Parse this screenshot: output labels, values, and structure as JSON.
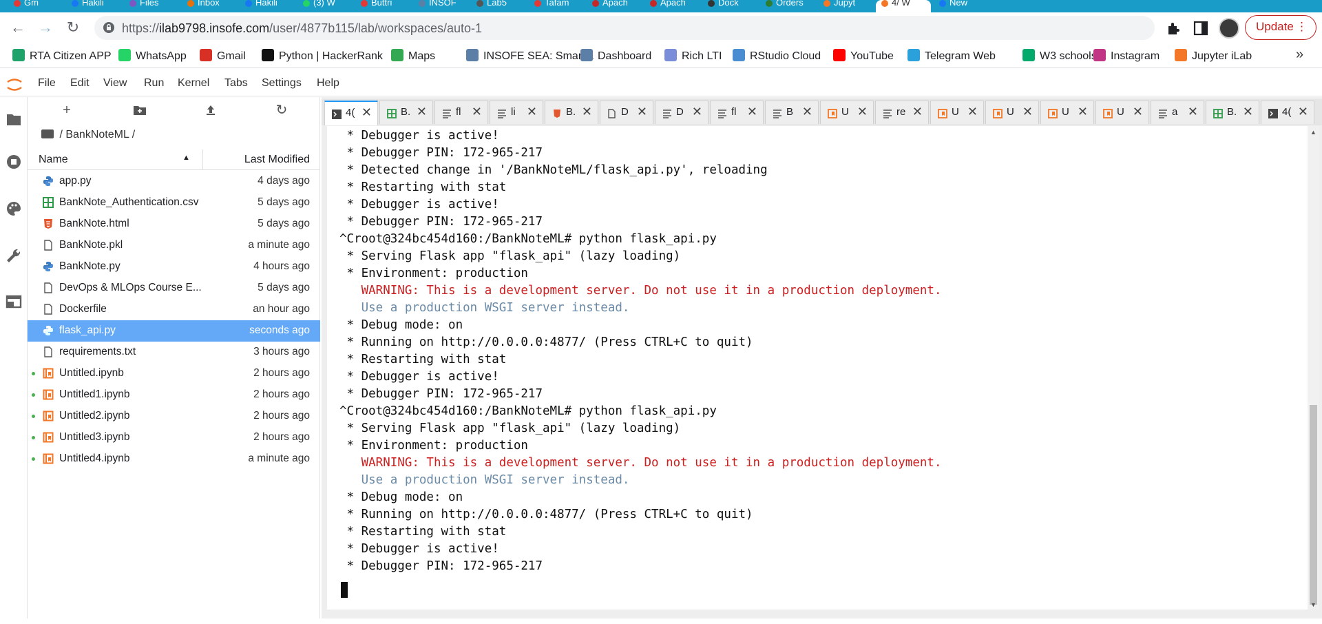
{
  "browser": {
    "tabs": [
      "Gm",
      "Hakili",
      "Files",
      "Inbox",
      "Hakili",
      "(3) W",
      "Buttri",
      "INSOF",
      "Lab5",
      "Tafam",
      "Apach",
      "Apach",
      "Dock",
      "Orders",
      "Jupyt",
      "4/ W",
      "New"
    ],
    "url_prefix": "https://",
    "url_domain": "ilab9798.insofe.com",
    "url_path": "/user/4877b115/lab/workspaces/auto-1",
    "update_label": "Update"
  },
  "bookmarks": [
    {
      "label": "RTA Citizen APP",
      "color": "#1fa36b"
    },
    {
      "label": "WhatsApp",
      "color": "#25d366"
    },
    {
      "label": "Gmail",
      "color": "#d93025"
    },
    {
      "label": "Python | HackerRank",
      "color": "#111111"
    },
    {
      "label": "Maps",
      "color": "#34a853"
    },
    {
      "label": "INSOFE SEA: Smart...",
      "color": "#5b7fa6"
    },
    {
      "label": "Dashboard",
      "color": "#5b7fa6"
    },
    {
      "label": "Rich LTI",
      "color": "#7a8dd8"
    },
    {
      "label": "RStudio Cloud",
      "color": "#4a8ed1"
    },
    {
      "label": "YouTube",
      "color": "#ff0000"
    },
    {
      "label": "Telegram Web",
      "color": "#2aa1da"
    },
    {
      "label": "W3 schools",
      "color": "#04aa6d"
    },
    {
      "label": "Instagram",
      "color": "#c13584"
    },
    {
      "label": "Jupyter iLab",
      "color": "#f37726"
    }
  ],
  "menu": [
    "File",
    "Edit",
    "View",
    "Run",
    "Kernel",
    "Tabs",
    "Settings",
    "Help"
  ],
  "filebrowser": {
    "breadcrumb": "/ BankNoteML /",
    "col_name": "Name",
    "col_modified": "Last Modified",
    "files": [
      {
        "name": "app.py",
        "modified": "4 days ago",
        "type": "py",
        "selected": false,
        "running": false
      },
      {
        "name": "BankNote_Authentication.csv",
        "modified": "5 days ago",
        "type": "csv",
        "selected": false,
        "running": false
      },
      {
        "name": "BankNote.html",
        "modified": "5 days ago",
        "type": "html",
        "selected": false,
        "running": false
      },
      {
        "name": "BankNote.pkl",
        "modified": "a minute ago",
        "type": "file",
        "selected": false,
        "running": false
      },
      {
        "name": "BankNote.py",
        "modified": "4 hours ago",
        "type": "py",
        "selected": false,
        "running": false
      },
      {
        "name": "DevOps & MLOps Course E...",
        "modified": "5 days ago",
        "type": "file",
        "selected": false,
        "running": false
      },
      {
        "name": "Dockerfile",
        "modified": "an hour ago",
        "type": "file",
        "selected": false,
        "running": false
      },
      {
        "name": "flask_api.py",
        "modified": "seconds ago",
        "type": "py",
        "selected": true,
        "running": false
      },
      {
        "name": "requirements.txt",
        "modified": "3 hours ago",
        "type": "file",
        "selected": false,
        "running": false
      },
      {
        "name": "Untitled.ipynb",
        "modified": "2 hours ago",
        "type": "nb",
        "selected": false,
        "running": true
      },
      {
        "name": "Untitled1.ipynb",
        "modified": "2 hours ago",
        "type": "nb",
        "selected": false,
        "running": true
      },
      {
        "name": "Untitled2.ipynb",
        "modified": "2 hours ago",
        "type": "nb",
        "selected": false,
        "running": true
      },
      {
        "name": "Untitled3.ipynb",
        "modified": "2 hours ago",
        "type": "nb",
        "selected": false,
        "running": true
      },
      {
        "name": "Untitled4.ipynb",
        "modified": "a minute ago",
        "type": "nb",
        "selected": false,
        "running": true
      }
    ]
  },
  "doc_tabs": [
    {
      "label": "4(",
      "type": "term",
      "active": true
    },
    {
      "label": "B.",
      "type": "csv",
      "active": false
    },
    {
      "label": "fl",
      "type": "text",
      "active": false
    },
    {
      "label": "li",
      "type": "text",
      "active": false
    },
    {
      "label": "B.",
      "type": "html",
      "active": false
    },
    {
      "label": "D",
      "type": "file",
      "active": false
    },
    {
      "label": "D",
      "type": "text",
      "active": false
    },
    {
      "label": "fl",
      "type": "text",
      "active": false
    },
    {
      "label": "B",
      "type": "text",
      "active": false
    },
    {
      "label": "U",
      "type": "nb",
      "active": false
    },
    {
      "label": "re",
      "type": "text",
      "active": false
    },
    {
      "label": "U",
      "type": "nb",
      "active": false
    },
    {
      "label": "U",
      "type": "nb",
      "active": false
    },
    {
      "label": "U",
      "type": "nb",
      "active": false
    },
    {
      "label": "U",
      "type": "nb",
      "active": false
    },
    {
      "label": "a",
      "type": "text",
      "active": false
    },
    {
      "label": "B.",
      "type": "csv",
      "active": false
    },
    {
      "label": "4(",
      "type": "term",
      "active": false
    }
  ],
  "terminal": {
    "lines": [
      {
        "text": " * Debugger is active!",
        "style": "normal"
      },
      {
        "text": " * Debugger PIN: 172-965-217",
        "style": "normal"
      },
      {
        "text": " * Detected change in '/BankNoteML/flask_api.py', reloading",
        "style": "normal"
      },
      {
        "text": " * Restarting with stat",
        "style": "normal"
      },
      {
        "text": " * Debugger is active!",
        "style": "normal"
      },
      {
        "text": " * Debugger PIN: 172-965-217",
        "style": "normal"
      },
      {
        "text": "^Croot@324bc454d160:/BankNoteML# python flask_api.py",
        "style": "normal"
      },
      {
        "text": " * Serving Flask app \"flask_api\" (lazy loading)",
        "style": "normal"
      },
      {
        "text": " * Environment: production",
        "style": "normal"
      },
      {
        "text": "   WARNING: This is a development server. Do not use it in a production deployment.",
        "style": "red"
      },
      {
        "text": "   Use a production WSGI server instead.",
        "style": "gray"
      },
      {
        "text": " * Debug mode: on",
        "style": "normal"
      },
      {
        "text": " * Running on http://0.0.0.0:4877/ (Press CTRL+C to quit)",
        "style": "normal"
      },
      {
        "text": " * Restarting with stat",
        "style": "normal"
      },
      {
        "text": " * Debugger is active!",
        "style": "normal"
      },
      {
        "text": " * Debugger PIN: 172-965-217",
        "style": "normal"
      },
      {
        "text": "^Croot@324bc454d160:/BankNoteML# python flask_api.py",
        "style": "normal"
      },
      {
        "text": " * Serving Flask app \"flask_api\" (lazy loading)",
        "style": "normal"
      },
      {
        "text": " * Environment: production",
        "style": "normal"
      },
      {
        "text": "   WARNING: This is a development server. Do not use it in a production deployment.",
        "style": "red"
      },
      {
        "text": "   Use a production WSGI server instead.",
        "style": "gray"
      },
      {
        "text": " * Debug mode: on",
        "style": "normal"
      },
      {
        "text": " * Running on http://0.0.0.0:4877/ (Press CTRL+C to quit)",
        "style": "normal"
      },
      {
        "text": " * Restarting with stat",
        "style": "normal"
      },
      {
        "text": " * Debugger is active!",
        "style": "normal"
      },
      {
        "text": " * Debugger PIN: 172-965-217",
        "style": "normal"
      }
    ]
  },
  "colors": {
    "browser_tabstrip": "#1a9cc9",
    "selected_row": "#64a9f7",
    "warning_red": "#cd1f1f",
    "hint_gray": "#6a8aa6",
    "python_icon": "#3a7cc4",
    "csv_icon": "#2e9b4a",
    "html_icon": "#e4572e",
    "notebook_icon": "#f37726"
  }
}
